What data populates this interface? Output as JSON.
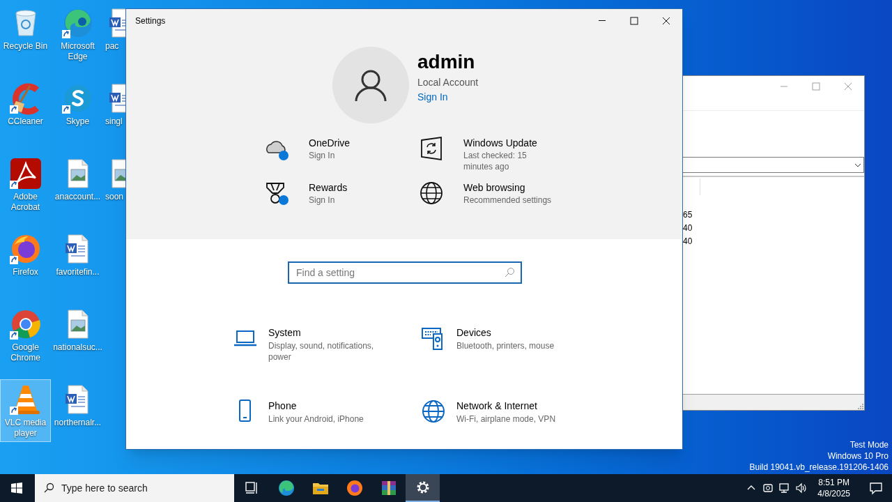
{
  "desktop": {
    "columns": [
      [
        {
          "label": "Recycle Bin",
          "kind": "recycle",
          "shortcut": false,
          "selected": false
        },
        {
          "label": "CCleaner",
          "kind": "ccleaner",
          "shortcut": true,
          "selected": false
        },
        {
          "label": "Adobe Acrobat",
          "kind": "acrobat",
          "shortcut": true,
          "selected": false
        },
        {
          "label": "Firefox",
          "kind": "firefox",
          "shortcut": true,
          "selected": false
        },
        {
          "label": "Google Chrome",
          "kind": "chrome",
          "shortcut": true,
          "selected": false
        },
        {
          "label": "VLC media player",
          "kind": "vlc",
          "shortcut": true,
          "selected": true
        }
      ],
      [
        {
          "label": "Microsoft Edge",
          "kind": "edge",
          "shortcut": true,
          "selected": false
        },
        {
          "label": "Skype",
          "kind": "skype",
          "shortcut": true,
          "selected": false
        },
        {
          "label": "anaccount...",
          "kind": "image",
          "shortcut": false,
          "selected": false
        },
        {
          "label": "favoritefin...",
          "kind": "word",
          "shortcut": false,
          "selected": false
        },
        {
          "label": "nationalsuc...",
          "kind": "image",
          "shortcut": false,
          "selected": false
        },
        {
          "label": "northernalr...",
          "kind": "word",
          "shortcut": false,
          "selected": false
        }
      ],
      [
        {
          "label": "pac",
          "kind": "word",
          "shortcut": false,
          "selected": false
        },
        {
          "label": "singl",
          "kind": "word",
          "shortcut": false,
          "selected": false
        },
        {
          "label": "soon",
          "kind": "image",
          "shortcut": false,
          "selected": false
        }
      ]
    ],
    "edition_lines": [
      "Test Mode",
      "Windows 10 Pro",
      "Build 19041.vb_release.191206-1406"
    ]
  },
  "background_window": {
    "list_values": [
      "65",
      "40",
      "40"
    ]
  },
  "settings": {
    "title": "Settings",
    "account": {
      "name": "admin",
      "type": "Local Account",
      "link": "Sign In"
    },
    "quick_links": [
      {
        "title": "OneDrive",
        "subtitle": "Sign In",
        "kind": "cloud",
        "badge": true
      },
      {
        "title": "Windows Update",
        "subtitle": "Last checked: 15 minutes ago",
        "kind": "update",
        "badge": false
      },
      {
        "title": "Rewards",
        "subtitle": "Sign In",
        "kind": "medal",
        "badge": true
      },
      {
        "title": "Web browsing",
        "subtitle": "Recommended settings",
        "kind": "globe",
        "badge": false
      }
    ],
    "search": {
      "placeholder": "Find a setting"
    },
    "categories": [
      {
        "title": "System",
        "subtitle": "Display, sound, notifications, power",
        "kind": "laptop"
      },
      {
        "title": "Devices",
        "subtitle": "Bluetooth, printers, mouse",
        "kind": "devices"
      },
      {
        "title": "Phone",
        "subtitle": "Link your Android, iPhone",
        "kind": "phone"
      },
      {
        "title": "Network & Internet",
        "subtitle": "Wi-Fi, airplane mode, VPN",
        "kind": "globe"
      }
    ]
  },
  "taskbar": {
    "search_placeholder": "Type here to search",
    "apps": [
      {
        "kind": "taskview",
        "active": false
      },
      {
        "kind": "edge",
        "active": false
      },
      {
        "kind": "explorer",
        "active": false
      },
      {
        "kind": "firefox",
        "active": false
      },
      {
        "kind": "winrar",
        "active": false
      },
      {
        "kind": "settings",
        "active": true
      }
    ],
    "time": "8:51 PM",
    "date": "4/8/2025"
  }
}
